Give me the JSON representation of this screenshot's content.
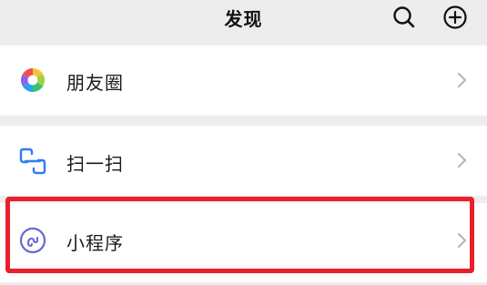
{
  "header": {
    "title": "发现",
    "icons": {
      "search": "search-icon",
      "add": "plus-circle-icon"
    }
  },
  "menu": {
    "items": [
      {
        "label": "朋友圈",
        "icon": "moments-icon"
      },
      {
        "label": "扫一扫",
        "icon": "scan-icon"
      },
      {
        "label": "小程序",
        "icon": "mini-program-icon"
      }
    ]
  },
  "colors": {
    "background": "#ededed",
    "row": "#ffffff",
    "highlight": "#e8202a",
    "scan_blue": "#2f7cf6",
    "mini_program_purple": "#6a67ce",
    "chevron": "#b2b2b2"
  }
}
